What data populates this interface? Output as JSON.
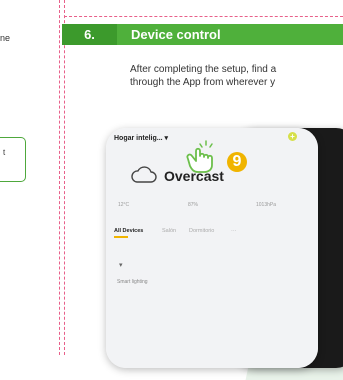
{
  "top_fragment": "ne",
  "left_box_text": "t",
  "section": {
    "number": "6.",
    "title": "Device control"
  },
  "paragraph": {
    "line1": "After completing the setup, find a",
    "line2": "through the App from wherever y"
  },
  "phone": {
    "home_label": "Hogar intelig... ▾",
    "add_symbol": "+",
    "weather": "Overcast",
    "stats": [
      "12°C",
      "87%",
      "1013hPa"
    ],
    "tabs": [
      "All Devices",
      "Salón",
      "Dormitorio",
      "···"
    ],
    "device_icon": "▾",
    "device_label": "Smart lighting"
  },
  "callout_number": "9",
  "colors": {
    "accent_green": "#4fb03b",
    "dark_green": "#3c9a2c",
    "badge_yellow": "#f0b400",
    "guide_pink": "#e8608a"
  },
  "icons": [
    "cloud-icon",
    "hand-tap-icon",
    "add-icon"
  ]
}
